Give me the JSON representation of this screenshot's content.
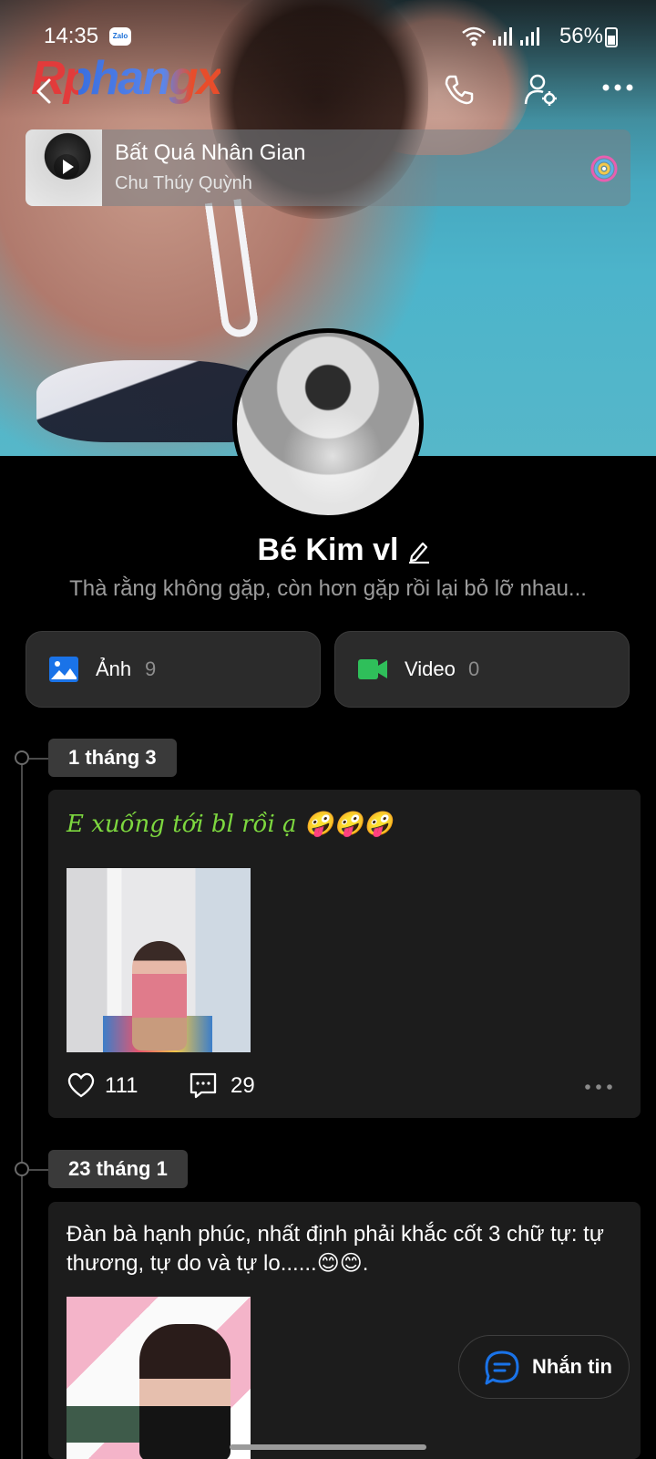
{
  "status_bar": {
    "time": "14:35",
    "notification_app": "Zalo",
    "battery": "56%"
  },
  "watermark": "Rphangx",
  "music": {
    "title": "Bất Quá Nhân Gian",
    "artist": "Chu Thúy Quỳnh"
  },
  "profile": {
    "name": "Bé Kim vl",
    "bio": "Thà rằng không gặp, còn hơn gặp rồi lại bỏ lỡ nhau..."
  },
  "media": {
    "photos_label": "Ảnh",
    "photos_count": "9",
    "videos_label": "Video",
    "videos_count": "0"
  },
  "posts": [
    {
      "date": "1 tháng 3",
      "text": "E xuống tới bl rồi ạ 🤪🤪🤪",
      "likes": "111",
      "comments": "29"
    },
    {
      "date": "23 tháng 1",
      "text": "Đàn bà hạnh phúc, nhất định phải khắc cốt 3 chữ tự: tự thương, tự do và tự lo......😊😊."
    }
  ],
  "chat_button": {
    "label": "Nhắn tin"
  },
  "colors": {
    "accent_blue": "#1a73e8",
    "video_green": "#2fbf5a",
    "post_green_text": "#7dd83f",
    "card_bg": "#1c1c1c"
  },
  "icons": [
    "back-icon",
    "phone-icon",
    "user-settings-icon",
    "more-icon",
    "play-icon",
    "music-disc-icon",
    "edit-icon",
    "photo-icon",
    "video-icon",
    "heart-icon",
    "comment-icon",
    "chat-icon"
  ]
}
